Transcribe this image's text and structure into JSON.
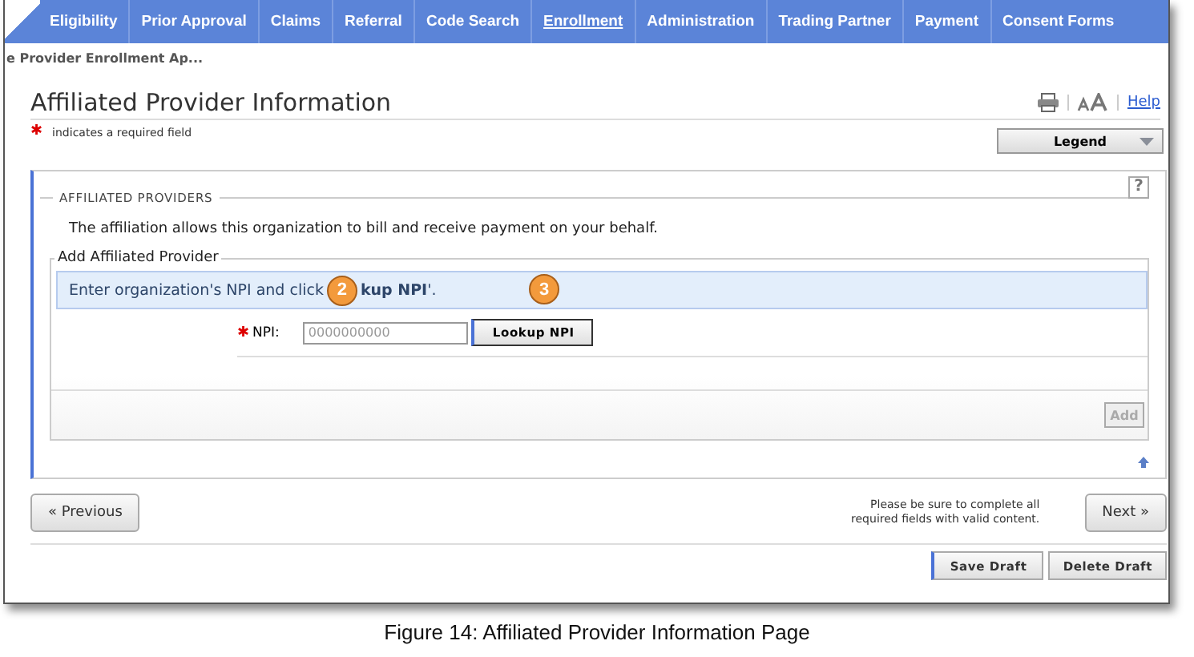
{
  "nav": [
    {
      "label": "Eligibility",
      "selected": false
    },
    {
      "label": "Prior Approval",
      "selected": false
    },
    {
      "label": "Claims",
      "selected": false
    },
    {
      "label": "Referral",
      "selected": false
    },
    {
      "label": "Code Search",
      "selected": false
    },
    {
      "label": "Enrollment",
      "selected": true
    },
    {
      "label": "Administration",
      "selected": false
    },
    {
      "label": "Trading Partner",
      "selected": false
    },
    {
      "label": "Payment",
      "selected": false
    },
    {
      "label": "Consent Forms",
      "selected": false
    }
  ],
  "breadcrumb": "e Provider Enrollment Ap...",
  "title": "Affiliated Provider Information",
  "help": "Help",
  "required_mark": "✱",
  "required_note": "indicates a required field",
  "help_mark": "?",
  "legend": "Legend",
  "section": {
    "title": "AFFILIATED PROVIDERS",
    "description": "The affiliation allows this organization to bill and receive payment on your behalf.",
    "subsection": {
      "title": "Add Affiliated Provider",
      "instruction_start": "Enter organization's NPI and click",
      "instruction_end": "**kup NPI**'.",
      "callouts": [
        "2",
        "3"
      ],
      "npi_required_mark": "✱",
      "npi_label": "NPI:",
      "npi_placeholder": "0000000000",
      "lookup_button": "Lookup NPI",
      "add_button": {
        "label": "Add",
        "disabled": true
      }
    }
  },
  "previous": "« Previous",
  "next": "Next »",
  "footer_note": "Please be sure to complete all required fields with valid content.",
  "save_draft": "Save Draft",
  "delete_draft": "Delete Draft",
  "caption": "Figure 14: Affiliated Provider Information Page"
}
